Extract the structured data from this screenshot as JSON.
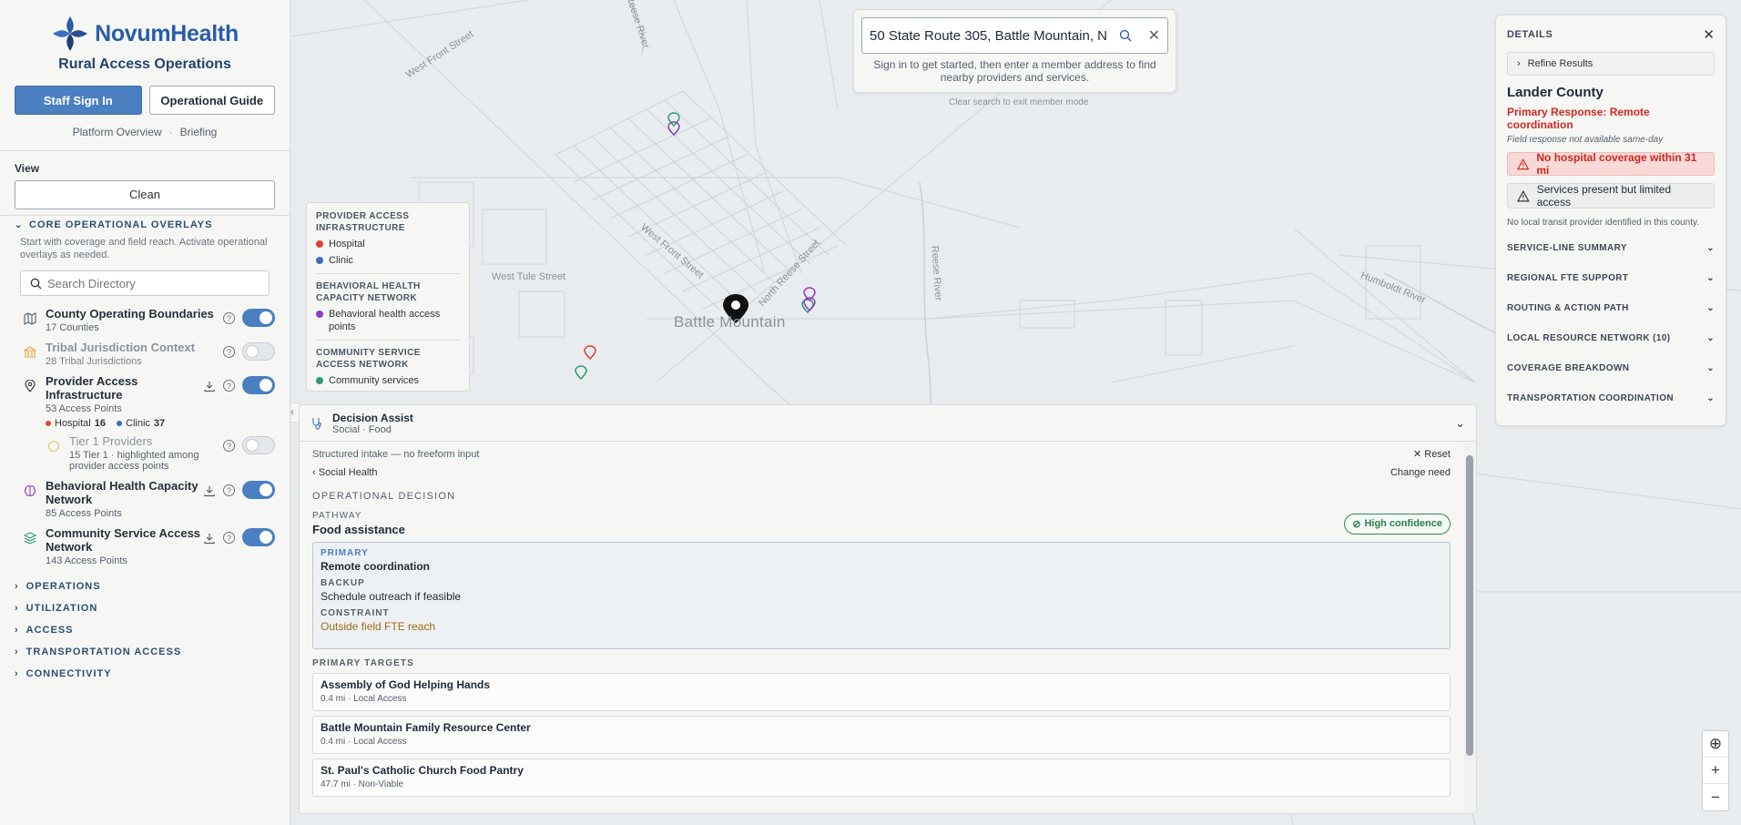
{
  "brand": {
    "name": "NovumHealth",
    "subtitle": "Rural Access Operations"
  },
  "auth": {
    "sign_in": "Staff Sign In",
    "guide": "Operational Guide"
  },
  "links": {
    "overview": "Platform Overview",
    "separator": "·",
    "briefing": "Briefing"
  },
  "view": {
    "label": "View",
    "value": "Clean"
  },
  "overlays": {
    "title": "CORE OPERATIONAL OVERLAYS",
    "hint": "Start with coverage and field reach. Activate operational overlays as needed.",
    "search_placeholder": "Search Directory",
    "layers": [
      {
        "title": "County Operating Boundaries",
        "count": "17 Counties",
        "enabled": true
      },
      {
        "title": "Tribal Jurisdiction Context",
        "count": "28 Tribal Jurisdictions",
        "enabled": false
      },
      {
        "title": "Provider Access Infrastructure",
        "count": "53 Access Points",
        "enabled": true,
        "hospital_label": "Hospital",
        "hospital_count": "16",
        "clinic_label": "Clinic",
        "clinic_count": "37"
      },
      {
        "title": "Tier 1 Providers",
        "count": "15 Tier 1 · highlighted among provider access points",
        "enabled": false
      },
      {
        "title": "Behavioral Health Capacity Network",
        "count": "85 Access Points",
        "enabled": true
      },
      {
        "title": "Community Service Access Network",
        "count": "143 Access Points",
        "enabled": true
      }
    ]
  },
  "sections": [
    "OPERATIONS",
    "UTILIZATION",
    "ACCESS",
    "TRANSPORTATION ACCESS",
    "CONNECTIVITY"
  ],
  "map": {
    "search_value": "50 State Route 305, Battle Mountain, N",
    "search_message": "Sign in to get started, then enter a member address to find nearby providers and services.",
    "clear_hint": "Clear search to exit member mode",
    "city": "Battle Mountain",
    "streets": [
      "West Front Street",
      "West Front Street",
      "West Tule Street",
      "North Reese Street",
      "Reese River",
      "Reese River",
      "Humboldt River"
    ],
    "legend": {
      "provider_head": "PROVIDER ACCESS INFRASTRUCTURE",
      "hospital": "Hospital",
      "clinic": "Clinic",
      "bh_head": "BEHAVIORAL HEALTH CAPACITY NETWORK",
      "bh_item": "Behavioral health access points",
      "cs_head": "COMMUNITY SERVICE ACCESS NETWORK",
      "cs_item": "Community services"
    },
    "colors": {
      "hospital": "#e0413a",
      "clinic": "#3d6fb6",
      "behavioral": "#8a3fc2",
      "community": "#2e9c6e"
    }
  },
  "decision": {
    "title": "Decision Assist",
    "subtitle": "Social · Food",
    "intake": "Structured intake — no freeform input",
    "reset": "Reset",
    "crumb": "Social Health",
    "change_need": "Change need",
    "op_label": "OPERATIONAL DECISION",
    "pathway_label": "PATHWAY",
    "pathway": "Food assistance",
    "confidence": "High confidence",
    "primary_label": "PRIMARY",
    "primary": "Remote coordination",
    "backup_label": "BACKUP",
    "backup": "Schedule outreach if feasible",
    "constraint_label": "CONSTRAINT",
    "constraint": "Outside field FTE reach",
    "targets_label": "PRIMARY TARGETS",
    "targets": [
      {
        "name": "Assembly of God Helping Hands",
        "meta": "0.4 mi · Local Access"
      },
      {
        "name": "Battle Mountain Family Resource Center",
        "meta": "0.4 mi · Local Access"
      },
      {
        "name": "St. Paul's Catholic Church Food Pantry",
        "meta": "47.7 mi · Non-Viable"
      }
    ]
  },
  "details": {
    "title": "DETAILS",
    "refine": "Refine Results",
    "county": "Lander County",
    "primary_response": "Primary Response: Remote coordination",
    "field_note": "Field response not available same-day",
    "alert_red": "No hospital coverage within 31 mi",
    "alert_gray": "Services present but limited access",
    "transit_note": "No local transit provider identified in this county.",
    "accordion": [
      "SERVICE-LINE SUMMARY",
      "REGIONAL FTE SUPPORT",
      "ROUTING & ACTION PATH",
      "LOCAL RESOURCE NETWORK (10)",
      "COVERAGE BREAKDOWN",
      "TRANSPORTATION COORDINATION"
    ]
  },
  "controls": {
    "locate": "⊕",
    "zoom_in": "+",
    "zoom_out": "−"
  }
}
